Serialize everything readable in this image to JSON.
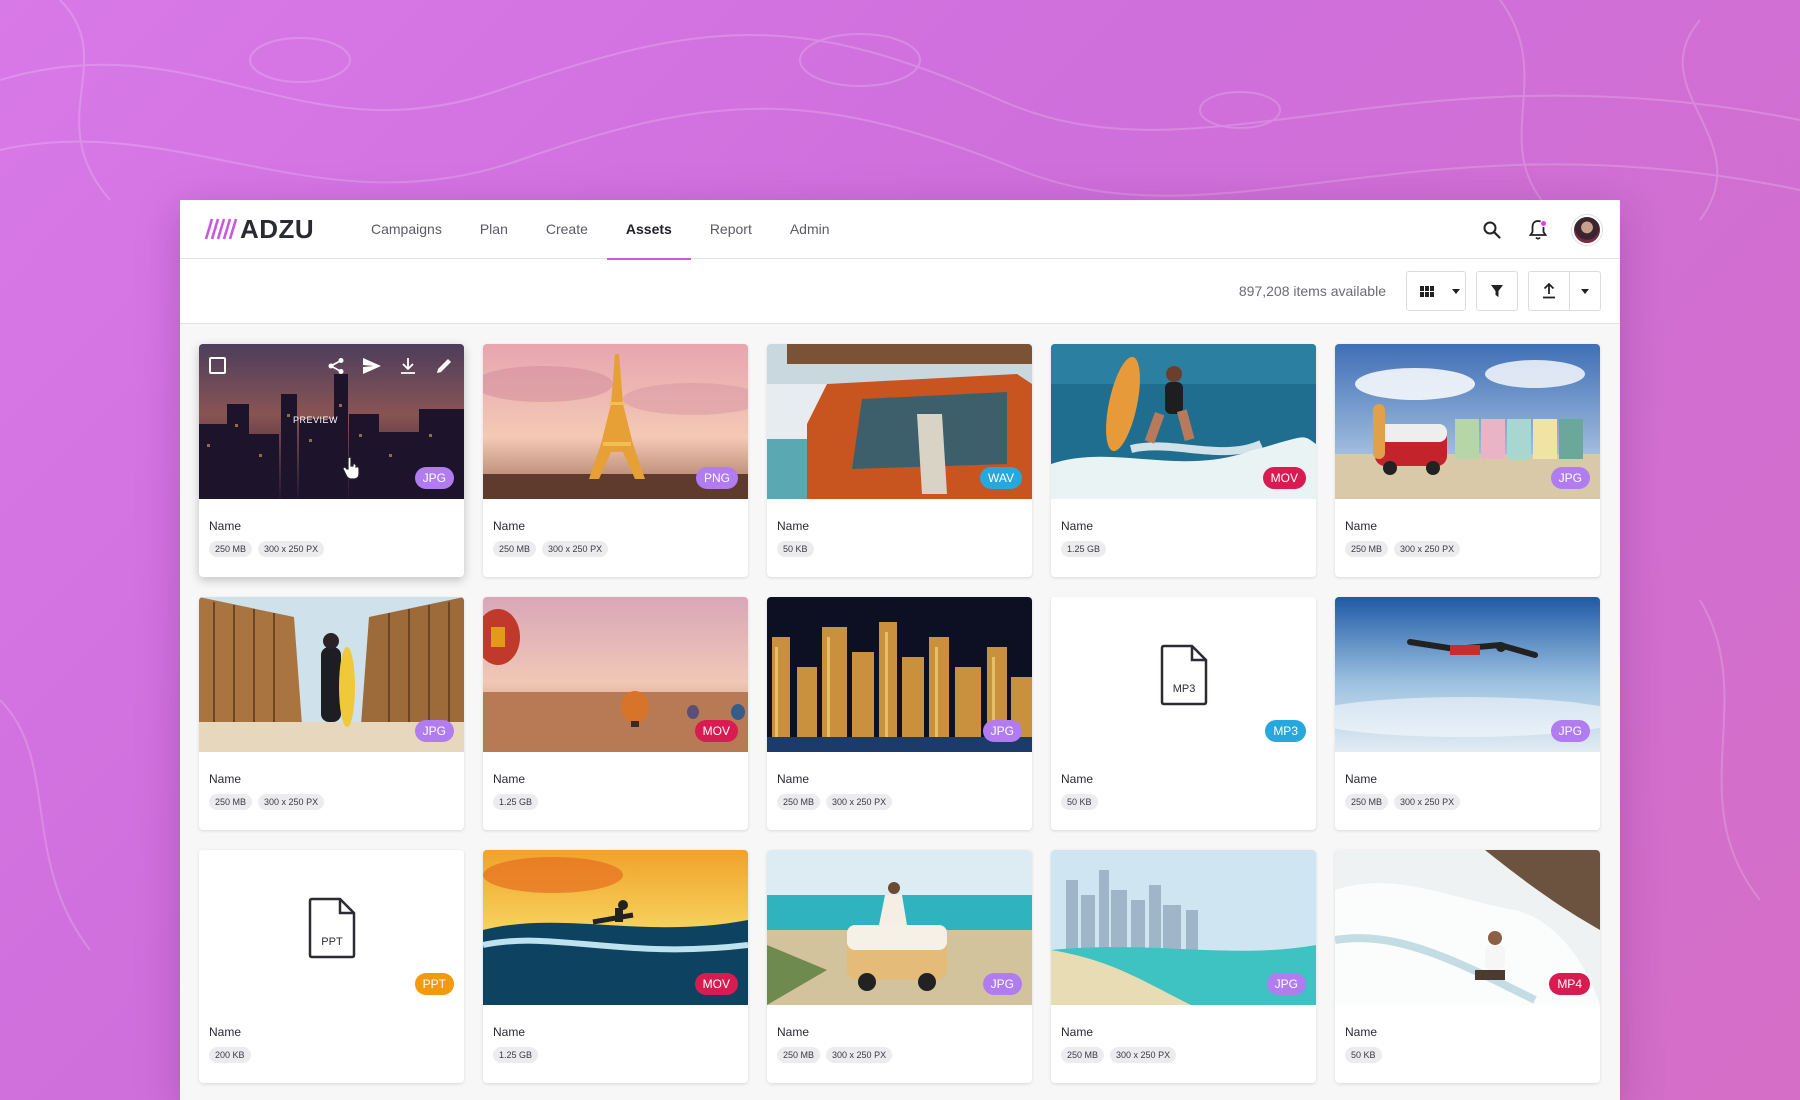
{
  "app": {
    "logo_text": "ADZU",
    "nav": [
      {
        "label": "Campaigns"
      },
      {
        "label": "Plan"
      },
      {
        "label": "Create"
      },
      {
        "label": "Assets"
      },
      {
        "label": "Report"
      },
      {
        "label": "Admin"
      }
    ],
    "active_nav": "Assets",
    "top_icons": [
      "search-icon",
      "bell-icon",
      "avatar"
    ]
  },
  "toolbar": {
    "items_count": "897,208 items available",
    "buttons": [
      "grid-view-icon",
      "filter-icon",
      "upload-icon"
    ]
  },
  "hover": {
    "preview_label": "PREVIEW",
    "actions": [
      "share-icon",
      "send-icon",
      "download-icon",
      "edit-icon"
    ]
  },
  "colors": {
    "accent": "#c85adf",
    "badge_jpg": "#b07cf0",
    "badge_png": "#b07cf0",
    "badge_wav": "#26a8dc",
    "badge_mov": "#d81b50",
    "badge_mp3": "#26a8dc",
    "badge_ppt": "#f29a0c",
    "badge_mp4": "#d81b50"
  },
  "assets": [
    {
      "name": "Name",
      "type": "JPG",
      "size": "250 MB",
      "dims": "300 x 250 PX"
    },
    {
      "name": "Name",
      "type": "PNG",
      "size": "250 MB",
      "dims": "300 x 250 PX"
    },
    {
      "name": "Name",
      "type": "WAV",
      "size": "50 KB",
      "dims": ""
    },
    {
      "name": "Name",
      "type": "MOV",
      "size": "1.25 GB",
      "dims": ""
    },
    {
      "name": "Name",
      "type": "JPG",
      "size": "250 MB",
      "dims": "300 x 250 PX"
    },
    {
      "name": "Name",
      "type": "JPG",
      "size": "250 MB",
      "dims": "300 x 250 PX"
    },
    {
      "name": "Name",
      "type": "MOV",
      "size": "1.25 GB",
      "dims": ""
    },
    {
      "name": "Name",
      "type": "JPG",
      "size": "250 MB",
      "dims": "300 x 250 PX"
    },
    {
      "name": "Name",
      "type": "MP3",
      "size": "50 KB",
      "dims": "",
      "file_label": "MP3"
    },
    {
      "name": "Name",
      "type": "JPG",
      "size": "250 MB",
      "dims": "300 x 250 PX"
    },
    {
      "name": "Name",
      "type": "PPT",
      "size": "200 KB",
      "dims": "",
      "file_label": "PPT"
    },
    {
      "name": "Name",
      "type": "MOV",
      "size": "1.25 GB",
      "dims": ""
    },
    {
      "name": "Name",
      "type": "JPG",
      "size": "250 MB",
      "dims": "300 x 250 PX"
    },
    {
      "name": "Name",
      "type": "JPG",
      "size": "250 MB",
      "dims": "300 x 250 PX"
    },
    {
      "name": "Name",
      "type": "MP4",
      "size": "50 KB",
      "dims": ""
    }
  ]
}
